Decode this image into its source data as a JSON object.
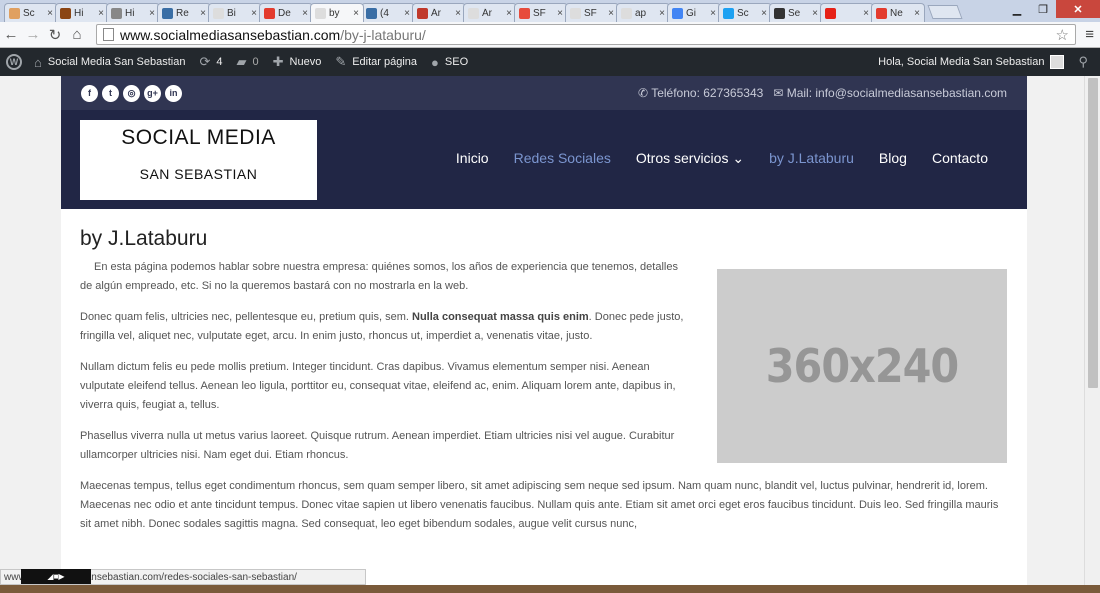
{
  "browser": {
    "tabs": [
      {
        "title": "Sc",
        "color": "#e0a060"
      },
      {
        "title": "Hi",
        "color": "#8b4513"
      },
      {
        "title": "Hi",
        "color": "#888888"
      },
      {
        "title": "Re",
        "color": "#3a6ea5"
      },
      {
        "title": "Bi",
        "color": "#dddddd"
      },
      {
        "title": "De",
        "color": "#e33b2e"
      },
      {
        "title": "by",
        "color": "#dddddd",
        "active": true
      },
      {
        "title": "(4",
        "color": "#3a6ea5"
      },
      {
        "title": "Ár",
        "color": "#c0392b"
      },
      {
        "title": "Ár",
        "color": "#dddddd"
      },
      {
        "title": "SF",
        "color": "#e74c3c"
      },
      {
        "title": "SF",
        "color": "#dddddd"
      },
      {
        "title": "ap",
        "color": "#dddddd"
      },
      {
        "title": "Gi",
        "color": "#4285f4"
      },
      {
        "title": "Sc",
        "color": "#1da1f2"
      },
      {
        "title": "Se",
        "color": "#333333"
      },
      {
        "title": "",
        "color": "#e62117"
      },
      {
        "title": "Ne",
        "color": "#e33b2e"
      }
    ],
    "url_host": "www.socialmediasansebastian.com",
    "url_path": "/by-j-lataburu/",
    "status_url": "www.socialmediasansebastian.com/redes-sociales-san-sebastian/"
  },
  "adminbar": {
    "site_name": "Social Media San Sebastian",
    "updates": "4",
    "comments": "0",
    "new_label": "Nuevo",
    "edit_label": "Editar página",
    "seo_label": "SEO",
    "greeting": "Hola, Social Media San Sebastian"
  },
  "site": {
    "phone": "Teléfono: 627365343",
    "mail": "Mail: info@socialmediasansebastian.com",
    "logo_line1": "SOCIAL MEDIA",
    "logo_line2": "SAN SEBASTIAN",
    "nav": [
      {
        "label": "Inicio"
      },
      {
        "label": "Redes Sociales",
        "current": true
      },
      {
        "label": "Otros servicios ⌄"
      },
      {
        "label": "by J.Lataburu",
        "current": true
      },
      {
        "label": "Blog"
      },
      {
        "label": "Contacto"
      }
    ]
  },
  "content": {
    "title": "by J.Lataburu",
    "placeholder": "360x240",
    "p1": "En esta página podemos hablar sobre nuestra empresa: quiénes somos, los años de experiencia que tenemos, detalles de algún empreado, etc. Si no la queremos bastará con no mostrarla en la web.",
    "p2_a": "Donec quam felis, ultricies nec, pellentesque eu, pretium quis, sem. ",
    "p2_bold": "Nulla consequat massa quis enim",
    "p2_b": ". Donec pede justo, fringilla vel, aliquet nec, vulputate eget, arcu. In enim justo, rhoncus ut, imperdiet a, venenatis vitae, justo.",
    "p3": "Nullam dictum felis eu pede mollis pretium. Integer tincidunt. Cras dapibus. Vivamus elementum semper nisi. Aenean vulputate eleifend tellus. Aenean leo ligula, porttitor eu, consequat vitae, eleifend ac, enim. Aliquam lorem ante, dapibus in, viverra quis, feugiat a, tellus.",
    "p4": "Phasellus viverra nulla ut metus varius laoreet. Quisque rutrum. Aenean imperdiet. Etiam ultricies nisi vel augue. Curabitur ullamcorper ultricies nisi. Nam eget dui. Etiam rhoncus.",
    "p5": "Maecenas tempus, tellus eget condimentum rhoncus, sem quam semper libero, sit amet adipiscing sem neque sed ipsum. Nam quam nunc, blandit vel, luctus pulvinar, hendrerit id, lorem. Maecenas nec odio et ante tincidunt tempus. Donec vitae sapien ut libero venenatis faucibus. Nullam quis ante. Etiam sit amet orci eget eros faucibus tincidunt. Duis leo. Sed fringilla mauris sit amet nibh. Donec sodales sagittis magna. Sed consequat, leo eget bibendum sodales, augue velit cursus nunc,"
  }
}
